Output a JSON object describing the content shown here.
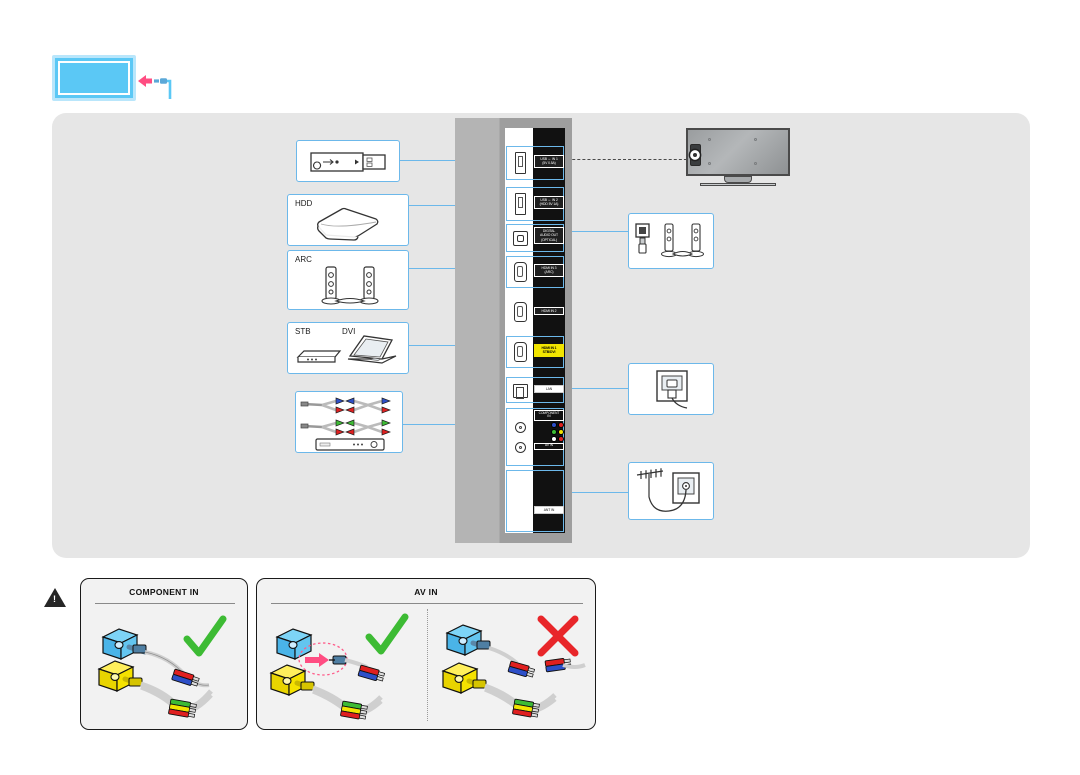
{
  "document": {
    "type": "tv-rear-panel-connection-diagram",
    "header_icon": "tv-screen-cable-icon"
  },
  "ports": [
    {
      "id": "usb-in-1",
      "label": "USB ⇔ IN 1\n(5V 0.5A)",
      "shape": "usb",
      "highlight": true,
      "style": "white"
    },
    {
      "id": "usb-in-2",
      "label": "USB ⇔ IN 2\n(HDD 5V 1A)",
      "shape": "usb",
      "highlight": true,
      "style": "white"
    },
    {
      "id": "digital-audio-out",
      "label": "DIGITAL\nAUDIO OUT\n(OPTICAL)",
      "shape": "optical",
      "highlight": true,
      "style": "white"
    },
    {
      "id": "hdmi-in-3",
      "label": "HDMI IN 3\n(ARC)",
      "shape": "hdmi",
      "highlight": true,
      "style": "white"
    },
    {
      "id": "hdmi-in-2",
      "label": "HDMI IN 2",
      "shape": "hdmi",
      "highlight": false,
      "style": "white"
    },
    {
      "id": "hdmi-in-1",
      "label": "HDMI IN 1\nSTB/DVI",
      "shape": "hdmi",
      "highlight": true,
      "style": "yellow"
    },
    {
      "id": "lan",
      "label": "LAN",
      "shape": "lan",
      "highlight": true,
      "style": "plain"
    },
    {
      "id": "component-av-in",
      "label": "COMPONENT\nIN",
      "shape": "rca",
      "highlight": true,
      "style": "white"
    },
    {
      "id": "ant-in",
      "label": "ANT IN",
      "shape": "ant",
      "highlight": true,
      "style": "plain"
    }
  ],
  "av_in_label": "AV IN",
  "devices_left": [
    {
      "id": "usb-flash-drive",
      "label": "",
      "icon": "usb-flash-drive-icon"
    },
    {
      "id": "hdd",
      "label": "HDD",
      "icon": "external-hard-drive-icon"
    },
    {
      "id": "arc-speakers",
      "label": "ARC",
      "icon": "soundbar-speakers-icon"
    },
    {
      "id": "stb-dvi",
      "label1": "STB",
      "label2": "DVI",
      "icon": "set-top-box-laptop-icon"
    },
    {
      "id": "component-cables",
      "label": "",
      "icon": "component-cables-dvd-player-icon"
    }
  ],
  "devices_right": [
    {
      "id": "optical-speakers",
      "icon": "optical-audio-speakers-icon"
    },
    {
      "id": "lan-wall-jack",
      "icon": "lan-wall-outlet-icon"
    },
    {
      "id": "antenna-wall-jack",
      "icon": "antenna-wall-outlet-icon"
    }
  ],
  "tv_rear": {
    "id": "tv-rear-view",
    "icon": "tv-rear-panel-icon"
  },
  "warnings": {
    "component_panel": {
      "title": "COMPONENT IN",
      "examples": [
        {
          "state": "correct",
          "mark": "check"
        }
      ]
    },
    "av_panel": {
      "title": "AV IN",
      "examples": [
        {
          "state": "correct",
          "mark": "check"
        },
        {
          "state": "incorrect",
          "mark": "cross"
        }
      ]
    }
  },
  "colors": {
    "panel_bg": "#e6e6e6",
    "connector_blue": "#6cb8ea",
    "accent_blue": "#5bc8f5",
    "highlight_yellow": "#f2e500",
    "check_green": "#3dbb34",
    "cross_red": "#e8262a",
    "pink_arrow": "#ff4d82",
    "strip_dark": "#111111"
  },
  "jack_colors": {
    "component": [
      {
        "row": "y-pb-pr",
        "dots": [
          "#2d4fc8",
          "#e02020"
        ]
      },
      {
        "row": "video",
        "dots": [
          "#3dbb34",
          "#f2e500"
        ]
      },
      {
        "row": "audio",
        "dots": [
          "#ffffff",
          "#e02020"
        ]
      }
    ]
  }
}
